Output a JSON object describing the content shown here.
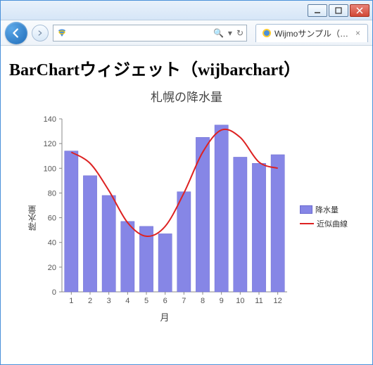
{
  "window": {
    "tab_title": "Wijmoサンプル（近…",
    "address_value": "",
    "search_icon": "🔍",
    "refresh_icon": "↻"
  },
  "page": {
    "heading": "BarChartウィジェット（wijbarchart）"
  },
  "chart_data": {
    "type": "bar",
    "title": "札幌の降水量",
    "xlabel": "月",
    "ylabel": "降水量",
    "categories": [
      "1",
      "2",
      "3",
      "4",
      "5",
      "6",
      "7",
      "8",
      "9",
      "10",
      "11",
      "12"
    ],
    "values": [
      114,
      94,
      78,
      57,
      53,
      47,
      81,
      125,
      135,
      109,
      104,
      111
    ],
    "trendline": [
      113,
      104,
      82,
      56,
      45,
      53,
      80,
      113,
      131,
      125,
      105,
      100
    ],
    "ylim": [
      0,
      140
    ],
    "yticks": [
      0,
      20,
      40,
      60,
      80,
      100,
      120,
      140
    ],
    "series": [
      {
        "name": "降水量",
        "kind": "bar"
      },
      {
        "name": "近似曲線",
        "kind": "line"
      }
    ]
  },
  "legend": {
    "bar_label": "降水量",
    "line_label": "近似曲線"
  }
}
